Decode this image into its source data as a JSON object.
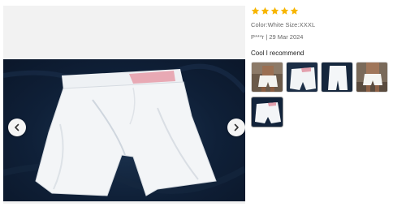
{
  "review": {
    "rating": 5,
    "rating_max": 5,
    "star_color": "#f7b500",
    "sku_text": "Color:White Size:XXXL",
    "author_date": "P***r | 29 Mar 2024",
    "text": "Cool I recommend"
  },
  "viewer": {
    "prev_icon": "chevron-left-icon",
    "next_icon": "chevron-right-icon",
    "current_photo": 1
  },
  "thumbnails": [
    {
      "name": "thumb-1",
      "subject": "person wearing shorts"
    },
    {
      "name": "thumb-2",
      "subject": "shorts flat lay"
    },
    {
      "name": "thumb-3",
      "subject": "shorts on dark background"
    },
    {
      "name": "thumb-4",
      "subject": "person wearing shorts"
    },
    {
      "name": "thumb-5",
      "subject": "shorts flat lay"
    }
  ],
  "colors": {
    "background_dark": "#0f2038",
    "shorts_white": "#f4f6f8"
  }
}
